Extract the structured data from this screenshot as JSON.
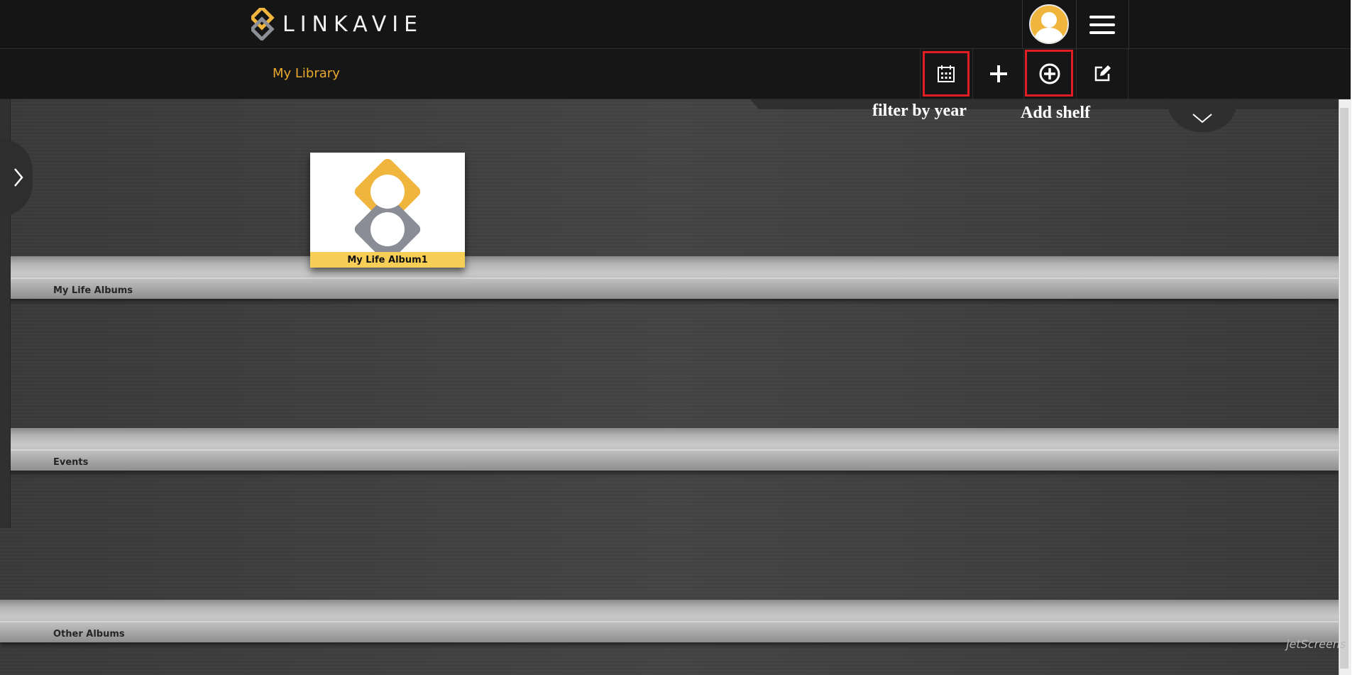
{
  "header": {
    "brand": "LINKAVIE",
    "avatar_icon": "user-avatar-icon",
    "menu_icon": "hamburger-menu-icon"
  },
  "toolbar": {
    "breadcrumb": "My Library",
    "buttons": [
      {
        "name": "calendar-icon",
        "action": "filter-by-year"
      },
      {
        "name": "plus-icon",
        "action": "add"
      },
      {
        "name": "plus-circle-icon",
        "action": "add-shelf"
      },
      {
        "name": "edit-icon",
        "action": "edit"
      }
    ]
  },
  "annotations": {
    "filter_by_year": "filter by year",
    "add_shelf": "Add shelf"
  },
  "shelves": [
    {
      "label": "My Life Albums"
    },
    {
      "label": "Events"
    },
    {
      "label": "Other Albums"
    }
  ],
  "albums": [
    {
      "title": "My Life Album1",
      "shelf": "My Life Albums"
    }
  ],
  "watermark": "jetScreens",
  "colors": {
    "accent": "#e8a92e",
    "album_caption": "#f8cf56",
    "highlight": "#e21d24",
    "header_bg": "#151515"
  }
}
